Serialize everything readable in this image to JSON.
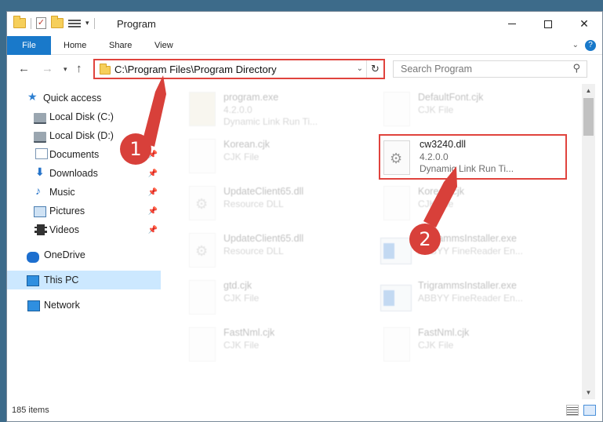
{
  "window": {
    "title": "Program",
    "controls": {
      "minimize": "–",
      "maximize": "□",
      "close": "✕"
    }
  },
  "ribbon": {
    "tabs": [
      {
        "label": "File"
      },
      {
        "label": "Home"
      },
      {
        "label": "Share"
      },
      {
        "label": "View"
      }
    ],
    "expand_icon": "chevron-down-icon",
    "help": "?"
  },
  "address_bar": {
    "path": "C:\\Program Files\\Program Directory",
    "highlight_color": "#e0433d"
  },
  "search": {
    "placeholder": "Search Program"
  },
  "nav_pane": {
    "items": [
      {
        "label": "Quick access",
        "icon": "star-icon"
      },
      {
        "label": "Local Disk (C:)",
        "icon": "drive-icon",
        "pinned": true
      },
      {
        "label": "Local Disk (D:)",
        "icon": "drive-icon",
        "pinned": true
      },
      {
        "label": "Documents",
        "icon": "document-icon",
        "pinned": true
      },
      {
        "label": "Downloads",
        "icon": "download-icon",
        "pinned": true
      },
      {
        "label": "Music",
        "icon": "music-icon",
        "pinned": true
      },
      {
        "label": "Pictures",
        "icon": "pictures-icon",
        "pinned": true
      },
      {
        "label": "Videos",
        "icon": "video-icon",
        "pinned": true
      },
      {
        "label": "OneDrive",
        "icon": "cloud-icon"
      },
      {
        "label": "This PC",
        "icon": "computer-icon",
        "selected": true
      },
      {
        "label": "Network",
        "icon": "network-icon"
      }
    ]
  },
  "files": [
    {
      "name": "program.exe",
      "line1": "4.2.0.0",
      "line2": "Dynamic Link Run Ti..."
    },
    {
      "name": "DefaultFont.cjk",
      "line1": "CJK File",
      "line2": ""
    },
    {
      "name": "Korean.cjk",
      "line1": "CJK File",
      "line2": ""
    },
    {
      "name": "cw3240.dll",
      "line1": "4.2.0.0",
      "line2": "Dynamic Link Run Ti...",
      "highlighted": true
    },
    {
      "name": "UpdateClient65.dll",
      "line1": "Resource DLL",
      "line2": ""
    },
    {
      "name": "Korean.cjk",
      "line1": "CJK File",
      "line2": ""
    },
    {
      "name": "UpdateClient65.dll",
      "line1": "Resource DLL",
      "line2": ""
    },
    {
      "name": "TrigrammsInstaller.exe",
      "line1": "ABBYY FineReader En...",
      "line2": ""
    },
    {
      "name": "gtd.cjk",
      "line1": "CJK File",
      "line2": ""
    },
    {
      "name": "TrigrammsInstaller.exe",
      "line1": "ABBYY FineReader En...",
      "line2": ""
    },
    {
      "name": "FastNml.cjk",
      "line1": "CJK File",
      "line2": ""
    },
    {
      "name": "FastNml.cjk",
      "line1": "CJK File",
      "line2": ""
    }
  ],
  "status": {
    "item_count": "185 items"
  },
  "annotations": [
    {
      "label": "1",
      "color": "#d8403a"
    },
    {
      "label": "2",
      "color": "#d8403a"
    }
  ]
}
